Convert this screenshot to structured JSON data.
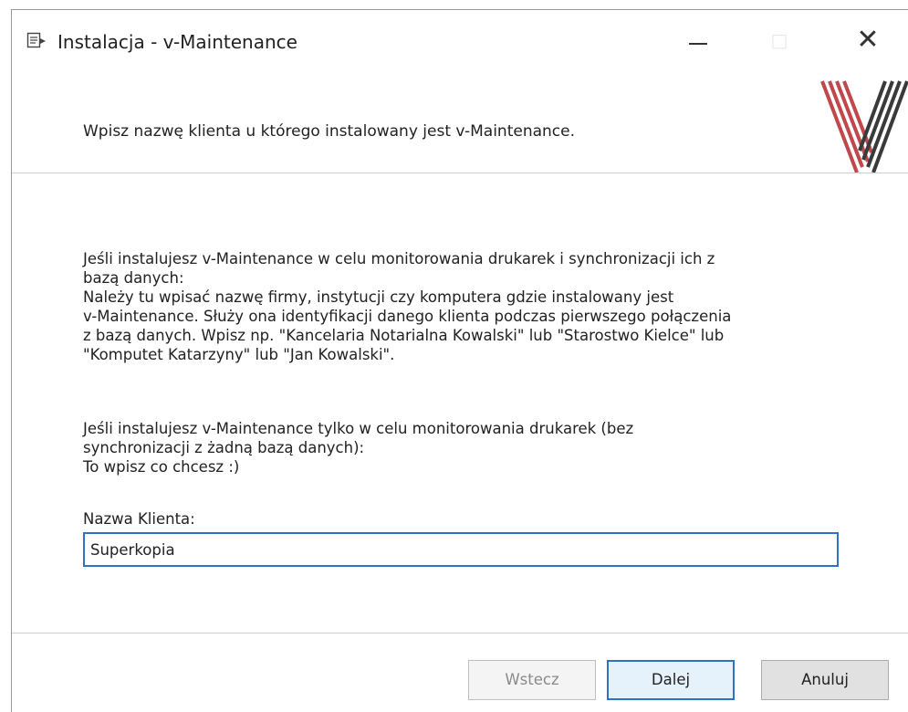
{
  "window": {
    "title": "Instalacja - v-Maintenance",
    "maximize_glyph": "□",
    "close_glyph": "✕",
    "icon": "installer-icon"
  },
  "header": {
    "instruction": "Wpisz nazwę klienta u którego instalowany jest v-Maintenance.",
    "logo": "v-maintenance-logo"
  },
  "content": {
    "paragraph1": [
      "Jeśli instalujesz v-Maintenance w celu monitorowania drukarek i synchronizacji ich z",
      "bazą danych:",
      "Należy tu wpisać nazwę firmy, instytucji czy komputera gdzie instalowany jest",
      "v-Maintenance. Służy ona identyfikacji danego klienta podczas pierwszego połączenia",
      "z bazą danych. Wpisz np. \"Kancelaria Notarialna Kowalski\" lub \"Starostwo Kielce\" lub",
      "\"Komputet Katarzyny\" lub \"Jan Kowalski\"."
    ],
    "paragraph2": [
      "Jeśli instalujesz v-Maintenance tylko w celu monitorowania drukarek (bez",
      "synchronizacji z żadną bazą danych):",
      "To wpisz co chcesz :)"
    ],
    "field_label": "Nazwa Klienta:",
    "field_value": "Superkopia"
  },
  "buttons": {
    "back": "Wstecz",
    "next": "Dalej",
    "cancel": "Anuluj"
  },
  "colors": {
    "accent": "#2c72c7",
    "logo_red": "#c0474a",
    "logo_dark": "#3a3a3a"
  }
}
